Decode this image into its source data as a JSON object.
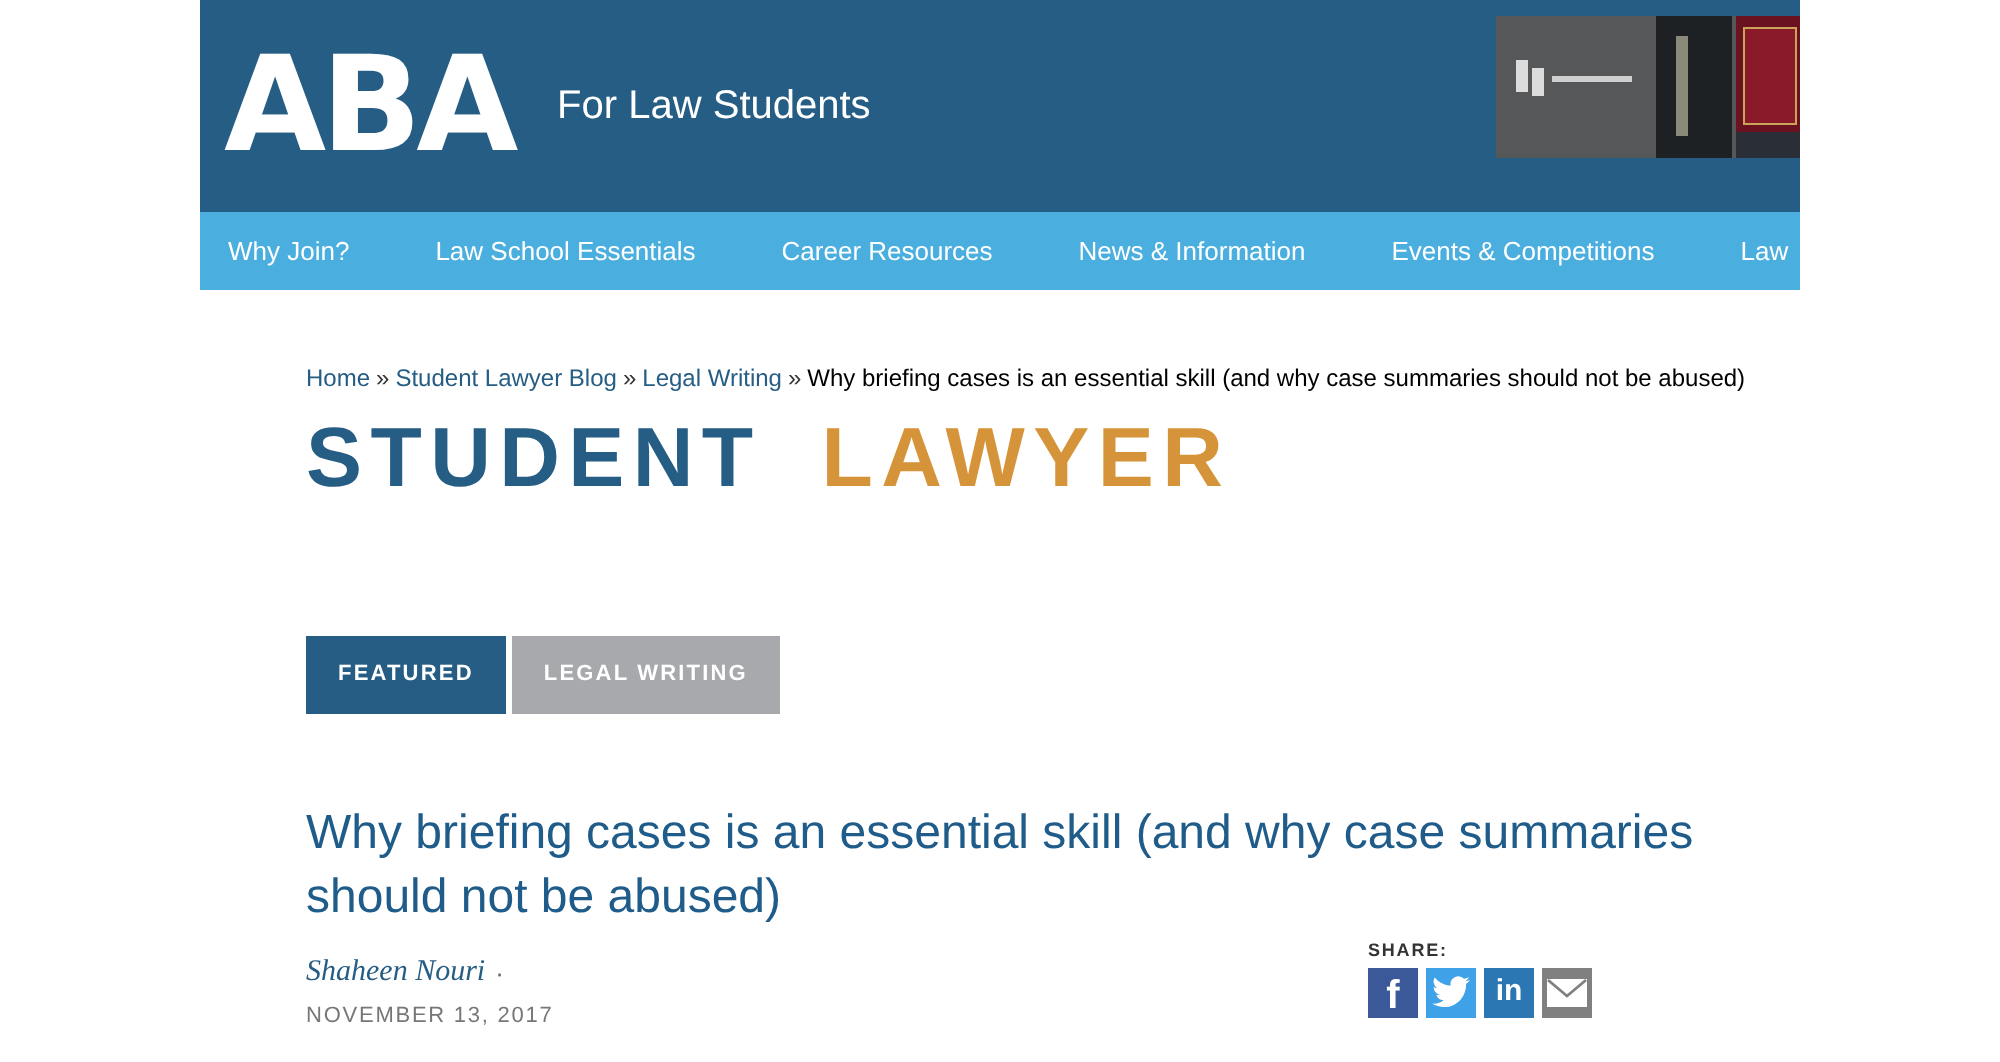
{
  "header": {
    "logo": "ABA",
    "site_title": "For Law Students"
  },
  "nav": [
    "Why Join?",
    "Law School Essentials",
    "Career Resources",
    "News & Information",
    "Events & Competitions",
    "Law"
  ],
  "breadcrumb": [
    {
      "label": "Home",
      "kind": "link"
    },
    {
      "label": "Student Lawyer Blog",
      "kind": "link"
    },
    {
      "label": "Legal Writing",
      "kind": "link"
    },
    {
      "label": "Why briefing cases is an essential skill (and why case summaries should not be abused)",
      "kind": "current"
    }
  ],
  "breadcrumb_separator": "»",
  "masthead": [
    {
      "text": "STUDENT",
      "color": "#255d84"
    },
    {
      "text": "LAWYER",
      "color": "#d6943a"
    }
  ],
  "tags": [
    {
      "label": "FEATURED",
      "selected": true
    },
    {
      "label": "LEGAL WRITING",
      "selected": false
    }
  ],
  "article": {
    "headline": "Why briefing cases is an essential skill (and why case summaries should not be abused)",
    "author": "Shaheen Nouri",
    "author_separator": "·",
    "date": "NOVEMBER 13, 2017"
  },
  "share": {
    "label": "SHARE:",
    "buttons": [
      {
        "kind": "glyph",
        "glyph": "f",
        "color": "#3b5998"
      },
      {
        "kind": "bird",
        "color": "#3fa2e8"
      },
      {
        "kind": "glyph",
        "glyph": "in",
        "color": "#2b77b3"
      },
      {
        "kind": "envelope",
        "color": "#808080"
      }
    ]
  }
}
